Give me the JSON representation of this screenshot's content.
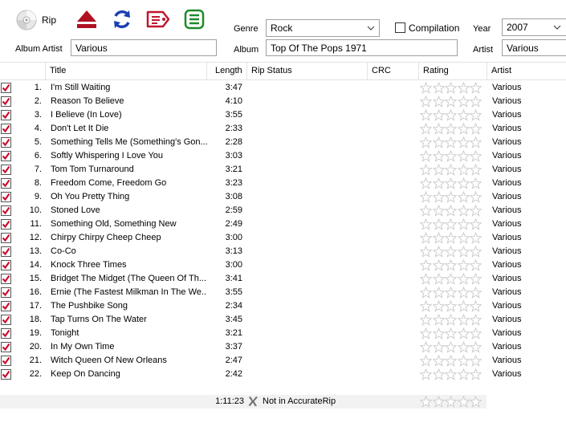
{
  "toolbar": {
    "rip_label": "Rip",
    "album_artist_label": "Album Artist",
    "album_artist_value": "Various",
    "genre_label": "Genre",
    "genre_value": "Rock",
    "album_label": "Album",
    "album_value": "Top Of The Pops 1971",
    "compilation_label": "Compilation",
    "compilation_checked": false,
    "year_label": "Year",
    "year_value": "2007",
    "artist_label": "Artist",
    "artist_value": "Various"
  },
  "columns": {
    "title": "Title",
    "length": "Length",
    "rip_status": "Rip Status",
    "crc": "CRC",
    "rating": "Rating",
    "artist": "Artist"
  },
  "tracks": [
    {
      "num": "1.",
      "title": "I'm Still Waiting",
      "length": "3:47",
      "artist": "Various",
      "checked": true,
      "rating": 0
    },
    {
      "num": "2.",
      "title": "Reason To Believe",
      "length": "4:10",
      "artist": "Various",
      "checked": true,
      "rating": 0
    },
    {
      "num": "3.",
      "title": "I Believe (In Love)",
      "length": "3:55",
      "artist": "Various",
      "checked": true,
      "rating": 0
    },
    {
      "num": "4.",
      "title": "Don't Let It Die",
      "length": "2:33",
      "artist": "Various",
      "checked": true,
      "rating": 0
    },
    {
      "num": "5.",
      "title": "Something Tells Me (Something's Gon...",
      "length": "2:28",
      "artist": "Various",
      "checked": true,
      "rating": 0
    },
    {
      "num": "6.",
      "title": "Softly Whispering I Love You",
      "length": "3:03",
      "artist": "Various",
      "checked": true,
      "rating": 0
    },
    {
      "num": "7.",
      "title": "Tom Tom Turnaround",
      "length": "3:21",
      "artist": "Various",
      "checked": true,
      "rating": 0
    },
    {
      "num": "8.",
      "title": "Freedom Come, Freedom Go",
      "length": "3:23",
      "artist": "Various",
      "checked": true,
      "rating": 0
    },
    {
      "num": "9.",
      "title": "Oh You Pretty Thing",
      "length": "3:08",
      "artist": "Various",
      "checked": true,
      "rating": 0
    },
    {
      "num": "10.",
      "title": "Stoned Love",
      "length": "2:59",
      "artist": "Various",
      "checked": true,
      "rating": 0
    },
    {
      "num": "11.",
      "title": "Something Old, Something New",
      "length": "2:49",
      "artist": "Various",
      "checked": true,
      "rating": 0
    },
    {
      "num": "12.",
      "title": "Chirpy Chirpy Cheep Cheep",
      "length": "3:00",
      "artist": "Various",
      "checked": true,
      "rating": 0
    },
    {
      "num": "13.",
      "title": "Co-Co",
      "length": "3:13",
      "artist": "Various",
      "checked": true,
      "rating": 0
    },
    {
      "num": "14.",
      "title": "Knock Three Times",
      "length": "3:00",
      "artist": "Various",
      "checked": true,
      "rating": 0
    },
    {
      "num": "15.",
      "title": "Bridget The Midget (The Queen Of Th...",
      "length": "3:41",
      "artist": "Various",
      "checked": true,
      "rating": 0
    },
    {
      "num": "16.",
      "title": "Ernie (The Fastest Milkman In The We...",
      "length": "3:55",
      "artist": "Various",
      "checked": true,
      "rating": 0
    },
    {
      "num": "17.",
      "title": "The Pushbike Song",
      "length": "2:34",
      "artist": "Various",
      "checked": true,
      "rating": 0
    },
    {
      "num": "18.",
      "title": "Tap Turns On The Water",
      "length": "3:45",
      "artist": "Various",
      "checked": true,
      "rating": 0
    },
    {
      "num": "19.",
      "title": "Tonight",
      "length": "3:21",
      "artist": "Various",
      "checked": true,
      "rating": 0
    },
    {
      "num": "20.",
      "title": "In My Own Time",
      "length": "3:37",
      "artist": "Various",
      "checked": true,
      "rating": 0
    },
    {
      "num": "21.",
      "title": "Witch Queen Of New Orleans",
      "length": "2:47",
      "artist": "Various",
      "checked": true,
      "rating": 0
    },
    {
      "num": "22.",
      "title": "Keep On Dancing",
      "length": "2:42",
      "artist": "Various",
      "checked": true,
      "rating": 0
    }
  ],
  "status": {
    "total_length": "1:11:23",
    "accuraterip_text": "Not in AccurateRip",
    "rating": 0
  },
  "icons": {
    "rip": "cd-disc-icon",
    "eject": "eject-icon",
    "refresh": "refresh-icon",
    "tag": "tag-edit-icon",
    "list": "tracklist-icon",
    "checkbox": "checked-checkbox-icon",
    "star": "star-outline-icon",
    "accuraterip": "x-mark-icon"
  },
  "colors": {
    "eject": "#b01020",
    "refresh": "#1a3fb0",
    "tag": "#c01830",
    "list": "#1f8a2a",
    "check": "#c8102e"
  }
}
